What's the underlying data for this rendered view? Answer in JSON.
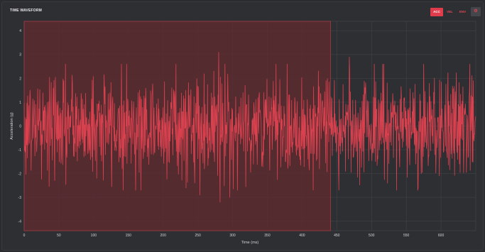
{
  "panel": {
    "title": "TIME WAVEFORM",
    "buttons": {
      "acc": "ACC",
      "vel": "VEL",
      "env": "ENV",
      "settings": "⚙"
    }
  },
  "colors": {
    "accent": "#e03c4b",
    "signal": "#d9414f",
    "highlight_fill": "#5b2c30",
    "highlight_stroke": "#b03b45",
    "grid": "#45464b"
  },
  "chart_data": {
    "type": "line",
    "title": "",
    "xlabel": "Time (ms)",
    "ylabel": "Acceleration (g)",
    "xlim": [
      0,
      650
    ],
    "ylim": [
      -4.4,
      4.4
    ],
    "xticks": [
      0,
      50,
      100,
      150,
      200,
      250,
      300,
      350,
      400,
      450,
      500,
      550,
      600
    ],
    "yticks": [
      4,
      3,
      2,
      1,
      0,
      -1,
      -2,
      -3,
      -4
    ],
    "highlight": {
      "x_start": 0,
      "x_end": 441
    },
    "sample_interval_ms": 0.5,
    "peaks": [
      {
        "x": 280,
        "y": 3.1
      },
      {
        "x": 468,
        "y": 2.9
      },
      {
        "x": 567,
        "y": 3.1
      },
      {
        "x": 523,
        "y": -2.4
      },
      {
        "x": 567,
        "y": -2.6
      },
      {
        "x": 282,
        "y": -3.2
      },
      {
        "x": 296,
        "y": -3.0
      },
      {
        "x": 253,
        "y": -2.9
      }
    ],
    "series": [
      {
        "amplitude_rms": 1.05,
        "max": 3.1,
        "min": -3.2
      }
    ]
  }
}
